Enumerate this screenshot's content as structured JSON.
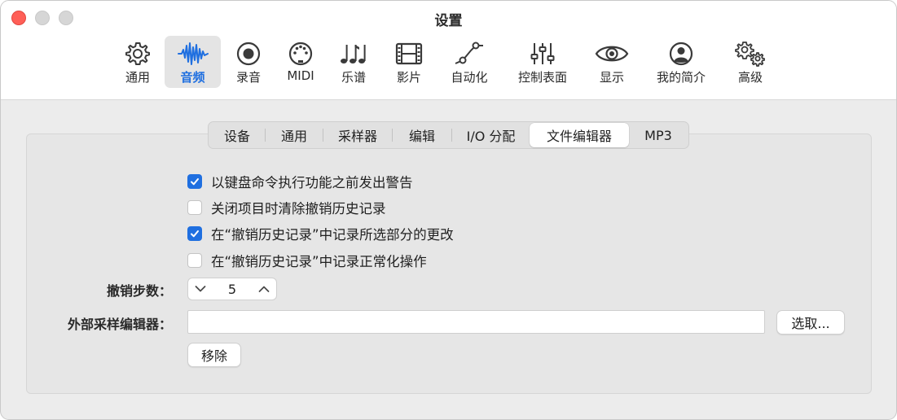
{
  "window": {
    "title": "设置"
  },
  "toolbar": {
    "items": [
      {
        "label": "通用",
        "icon": "gear-icon"
      },
      {
        "label": "音频",
        "icon": "waveform-icon",
        "active": true
      },
      {
        "label": "录音",
        "icon": "record-icon"
      },
      {
        "label": "MIDI",
        "icon": "midi-port-icon"
      },
      {
        "label": "乐谱",
        "icon": "music-notes-icon"
      },
      {
        "label": "影片",
        "icon": "film-icon"
      },
      {
        "label": "自动化",
        "icon": "automation-curve-icon"
      },
      {
        "label": "控制表面",
        "icon": "sliders-icon"
      },
      {
        "label": "显示",
        "icon": "eye-icon"
      },
      {
        "label": "我的简介",
        "icon": "person-icon"
      },
      {
        "label": "高级",
        "icon": "gears-icon"
      }
    ],
    "accent_color": "#1f6fe0"
  },
  "tabs": {
    "items": [
      "设备",
      "通用",
      "采样器",
      "编辑",
      "I/O 分配",
      "文件编辑器",
      "MP3"
    ],
    "selected": "文件编辑器"
  },
  "options": [
    {
      "label": "以键盘命令执行功能之前发出警告",
      "checked": true
    },
    {
      "label": "关闭项目时清除撤销历史记录",
      "checked": false
    },
    {
      "label": "在“撤销历史记录”中记录所选部分的更改",
      "checked": true
    },
    {
      "label": "在“撤销历史记录”中记录正常化操作",
      "checked": false
    }
  ],
  "undo_steps": {
    "label": "撤销步数：",
    "value": "5"
  },
  "external_editor": {
    "label": "外部采样编辑器：",
    "value": "",
    "choose_label": "选取...",
    "remove_label": "移除"
  },
  "colors": {
    "close": "#ff5f57",
    "checkbox_on": "#1f6fe0"
  }
}
